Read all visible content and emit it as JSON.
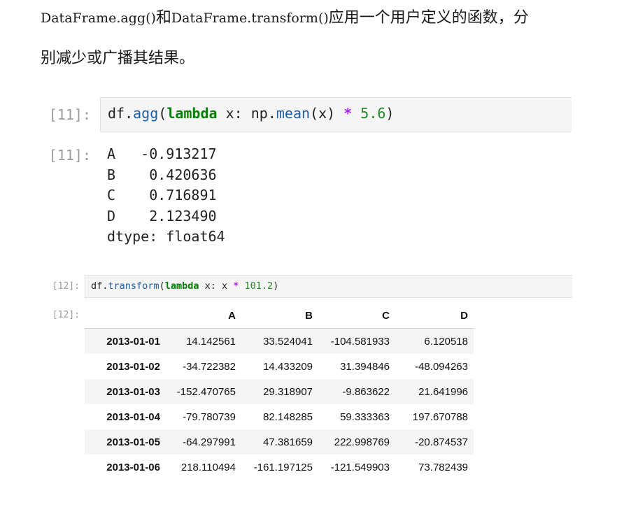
{
  "paragraph": {
    "code1": "DataFrame.agg()",
    "t1": "和",
    "code2": "DataFrame.transform()",
    "t2": "应用一个用户定义的函数，分",
    "line2": "别减少或广播其结果。"
  },
  "cell11": {
    "in_prompt": "[11]:",
    "out_prompt": "[11]:",
    "code": {
      "c1": "df",
      "c2": ".",
      "c3": "agg",
      "c4": "(",
      "c5": "lambda",
      "c6": " x: np",
      "c7": ".",
      "c8": "mean",
      "c9": "(x) ",
      "c10": "*",
      "c11": " ",
      "c12": "5.6",
      "c13": ")"
    },
    "output": {
      "rows": [
        {
          "label": "A",
          "value": "-0.913217"
        },
        {
          "label": "B",
          "value": "0.420636"
        },
        {
          "label": "C",
          "value": "0.716891"
        },
        {
          "label": "D",
          "value": "2.123490"
        }
      ],
      "dtype": "dtype: float64"
    }
  },
  "cell12": {
    "in_prompt": "[12]:",
    "out_prompt": "[12]:",
    "code": {
      "c1": "df",
      "c2": ".",
      "c3": "transform",
      "c4": "(",
      "c5": "lambda",
      "c6": " x: x ",
      "c7": "*",
      "c8": " ",
      "c9": "101.2",
      "c10": ")"
    },
    "table": {
      "columns": [
        "A",
        "B",
        "C",
        "D"
      ],
      "rows": [
        {
          "index": "2013-01-01",
          "values": [
            "14.142561",
            "33.524041",
            "-104.581933",
            "6.120518"
          ]
        },
        {
          "index": "2013-01-02",
          "values": [
            "-34.722382",
            "14.433209",
            "31.394846",
            "-48.094263"
          ]
        },
        {
          "index": "2013-01-03",
          "values": [
            "-152.470765",
            "29.318907",
            "-9.863622",
            "21.641996"
          ]
        },
        {
          "index": "2013-01-04",
          "values": [
            "-79.780739",
            "82.148285",
            "59.333363",
            "197.670788"
          ]
        },
        {
          "index": "2013-01-05",
          "values": [
            "-64.297991",
            "47.381659",
            "222.998769",
            "-20.874537"
          ]
        },
        {
          "index": "2013-01-06",
          "values": [
            "218.110494",
            "-161.197125",
            "-121.549903",
            "73.782439"
          ]
        }
      ]
    }
  }
}
